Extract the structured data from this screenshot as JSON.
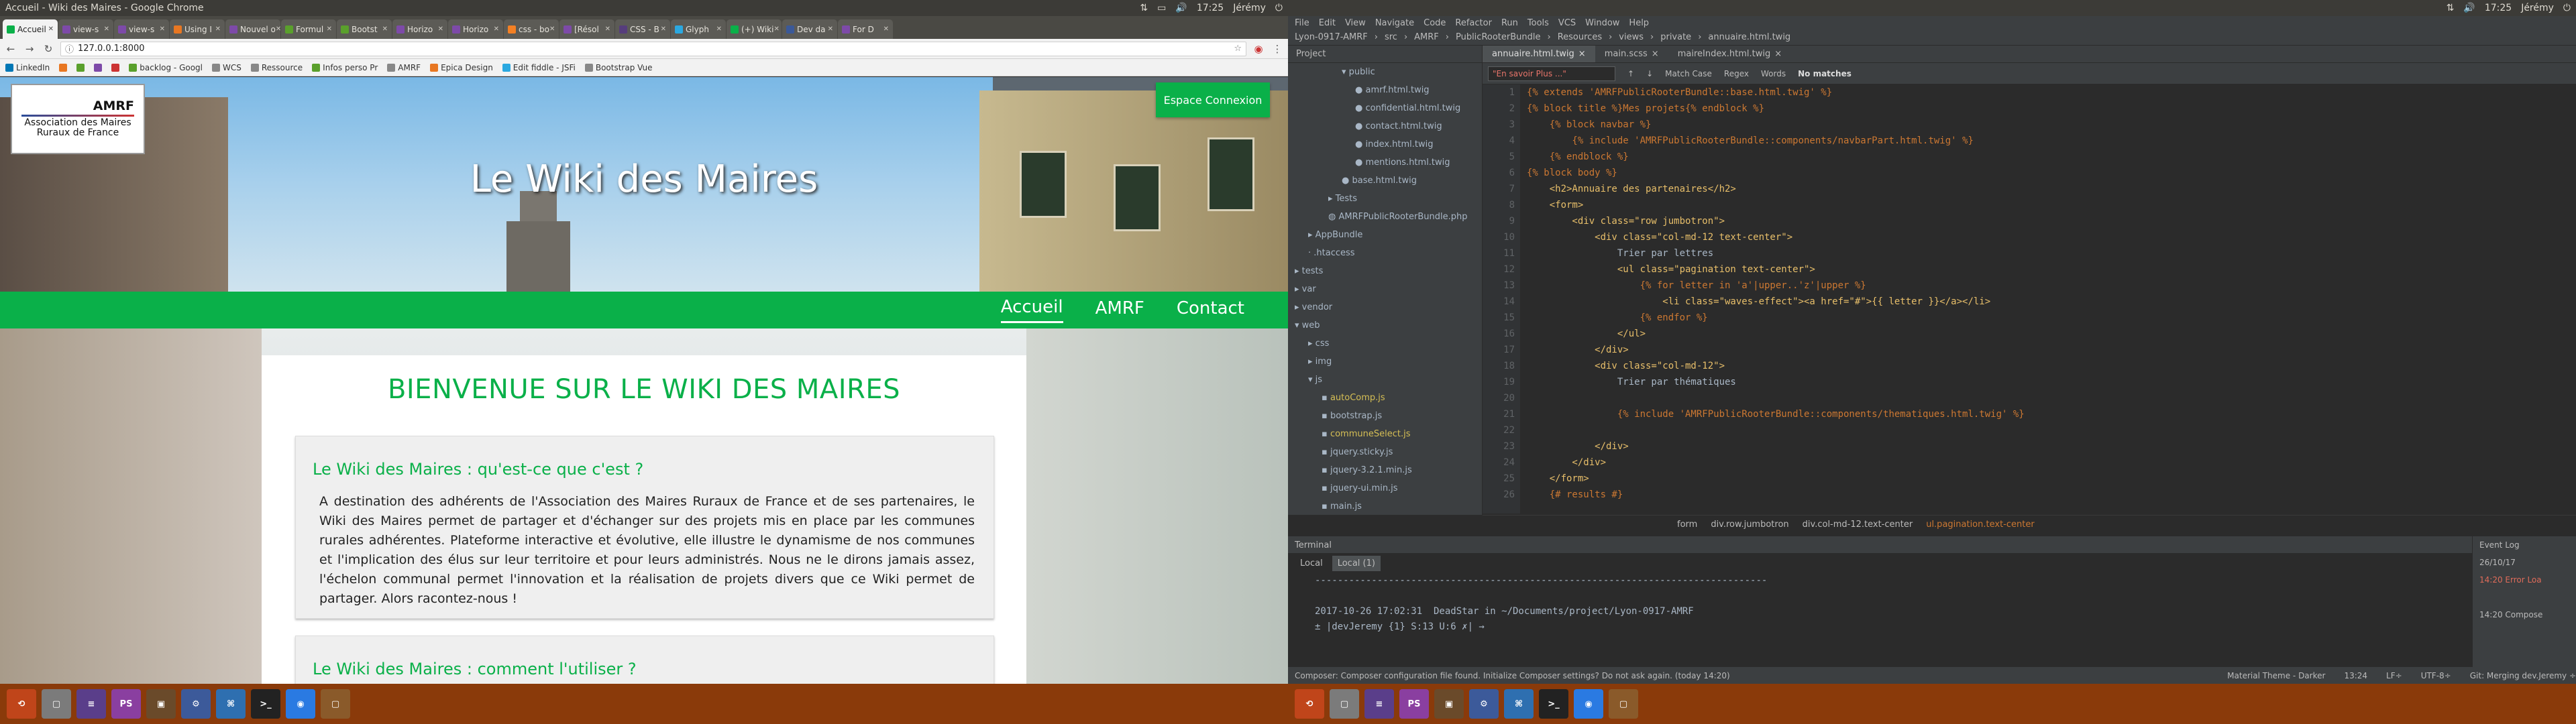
{
  "left": {
    "window_title": "Accueil - Wiki des Maires - Google Chrome",
    "tray": [
      "Jérémy"
    ],
    "tray_time": "17:25",
    "tabs": [
      {
        "label": "Accueil",
        "fav": "#0ab049"
      },
      {
        "label": "view-s",
        "fav": "#7d4aa8"
      },
      {
        "label": "view-s",
        "fav": "#7d4aa8"
      },
      {
        "label": "Using I",
        "fav": "#e87722"
      },
      {
        "label": "Nouvel o",
        "fav": "#7d4aa8"
      },
      {
        "label": "Formul",
        "fav": "#5aa02c"
      },
      {
        "label": "Bootst",
        "fav": "#5aa02c"
      },
      {
        "label": "Horizo",
        "fav": "#7d4aa8"
      },
      {
        "label": "Horizo",
        "fav": "#7d4aa8"
      },
      {
        "label": "css - bo",
        "fav": "#f48024"
      },
      {
        "label": "[Résol",
        "fav": "#7d4aa8"
      },
      {
        "label": "CSS - B",
        "fav": "#563d7c"
      },
      {
        "label": "Glyph",
        "fav": "#2ba8e0"
      },
      {
        "label": "(+) Wiki",
        "fav": "#0ab049"
      },
      {
        "label": "Dev da",
        "fav": "#3b5998"
      },
      {
        "label": "For D",
        "fav": "#7d4aa8"
      }
    ],
    "url": "127.0.0.1:8000",
    "bookmarks": [
      {
        "label": "LinkedIn",
        "color": "#0077b5"
      },
      {
        "label": "",
        "color": "#e87722"
      },
      {
        "label": "",
        "color": "#5aa02c"
      },
      {
        "label": "",
        "color": "#7d4aa8"
      },
      {
        "label": "",
        "color": "#c33"
      },
      {
        "label": "backlog - Googl",
        "color": "#5aa02c"
      },
      {
        "label": "WCS",
        "color": "#888"
      },
      {
        "label": "Ressource",
        "color": "#888"
      },
      {
        "label": "Infos perso Pr",
        "color": "#5aa02c"
      },
      {
        "label": "AMRF",
        "color": "#888"
      },
      {
        "label": "Epica Design",
        "color": "#e87722"
      },
      {
        "label": "Edit fiddle - JSFi",
        "color": "#2ba8e0"
      },
      {
        "label": "Bootstrap Vue",
        "color": "#888"
      }
    ],
    "site": {
      "logo_mark": "AMRF",
      "logo_line1": "Association des Maires",
      "logo_line2": "Ruraux de France",
      "espace": "Espace Connexion",
      "title": "Le Wiki des Maires",
      "nav": [
        "Accueil",
        "AMRF",
        "Contact"
      ],
      "heading": "BIENVENUE SUR LE WIKI DES MAIRES",
      "panel1_title": "Le Wiki des Maires : qu'est-ce que c'est ?",
      "panel1_text": "A destination des adhérents de l'Association des Maires Ruraux de France et de ses partenaires, le Wiki des Maires permet de partager et d'échanger sur des projets mis en place par les communes rurales adhérentes. Plateforme interactive et évolutive, elle illustre le dynamisme de nos communes et l'implication des élus sur leur territoire et pour leurs administrés. Nous ne le dirons jamais assez, l'échelon communal permet l'innovation et la réalisation de projets divers que ce Wiki permet de partager. Alors racontez-nous !",
      "panel2_title": "Le Wiki des Maires : comment l'utiliser ?"
    },
    "taskbar": [
      "⟲",
      "▢",
      "≡",
      "PS",
      "▣",
      "⚙",
      "⌘",
      ">_",
      "◉",
      "▢"
    ]
  },
  "right": {
    "tray_time": "17:25",
    "tray_user": "Jérémy",
    "menu": [
      "File",
      "Edit",
      "View",
      "Navigate",
      "Code",
      "Refactor",
      "Run",
      "Tools",
      "VCS",
      "Window",
      "Help"
    ],
    "breadcrumb": [
      "Lyon-0917-AMRF",
      "src",
      "AMRF",
      "PublicRooterBundle",
      "Resources",
      "views",
      "private",
      "annuaire.html.twig"
    ],
    "project_label": "Project",
    "tree": [
      {
        "label": "public",
        "indent": 80,
        "color": "#a9b7c6",
        "icon": "▾"
      },
      {
        "label": "amrf.html.twig",
        "indent": 100,
        "color": "#a9b7c6",
        "icon": "●"
      },
      {
        "label": "confidential.html.twig",
        "indent": 100,
        "color": "#a9b7c6",
        "icon": "●"
      },
      {
        "label": "contact.html.twig",
        "indent": 100,
        "color": "#a9b7c6",
        "icon": "●"
      },
      {
        "label": "index.html.twig",
        "indent": 100,
        "color": "#a9b7c6",
        "icon": "●"
      },
      {
        "label": "mentions.html.twig",
        "indent": 100,
        "color": "#a9b7c6",
        "icon": "●"
      },
      {
        "label": "base.html.twig",
        "indent": 80,
        "color": "#a9b7c6",
        "icon": "●"
      },
      {
        "label": "Tests",
        "indent": 60,
        "color": "#a9b7c6",
        "icon": "▸"
      },
      {
        "label": "AMRFPublicRooterBundle.php",
        "indent": 60,
        "color": "#a9b7c6",
        "icon": "◍"
      },
      {
        "label": "AppBundle",
        "indent": 30,
        "color": "#a9b7c6",
        "icon": "▸"
      },
      {
        "label": ".htaccess",
        "indent": 30,
        "color": "#a9b7c6",
        "icon": "·"
      },
      {
        "label": "tests",
        "indent": 10,
        "color": "#a9b7c6",
        "icon": "▸"
      },
      {
        "label": "var",
        "indent": 10,
        "color": "#a9b7c6",
        "icon": "▸"
      },
      {
        "label": "vendor",
        "indent": 10,
        "color": "#a9b7c6",
        "icon": "▸"
      },
      {
        "label": "web",
        "indent": 10,
        "color": "#a9b7c6",
        "icon": "▾"
      },
      {
        "label": "css",
        "indent": 30,
        "color": "#a9b7c6",
        "icon": "▸"
      },
      {
        "label": "img",
        "indent": 30,
        "color": "#a9b7c6",
        "icon": "▸"
      },
      {
        "label": "js",
        "indent": 30,
        "color": "#a9b7c6",
        "icon": "▾"
      },
      {
        "label": "autoComp.js",
        "indent": 50,
        "color": "#d6bf55",
        "icon": "▪"
      },
      {
        "label": "bootstrap.js",
        "indent": 50,
        "color": "#a9b7c6",
        "icon": "▪"
      },
      {
        "label": "communeSelect.js",
        "indent": 50,
        "color": "#d6bf55",
        "icon": "▪"
      },
      {
        "label": "jquery.sticky.js",
        "indent": 50,
        "color": "#a9b7c6",
        "icon": "▪"
      },
      {
        "label": "jquery-3.2.1.min.js",
        "indent": 50,
        "color": "#a9b7c6",
        "icon": "▪"
      },
      {
        "label": "jquery-ui.min.js",
        "indent": 50,
        "color": "#a9b7c6",
        "icon": "▪"
      },
      {
        "label": "main.js",
        "indent": 50,
        "color": "#a9b7c6",
        "icon": "▪"
      }
    ],
    "editor_tabs": [
      "annuaire.html.twig",
      "main.scss",
      "maireIndex.html.twig"
    ],
    "find_query": "\"En savoir Plus ...\"",
    "find_opts": [
      "Match Case",
      "Regex",
      "Words"
    ],
    "find_result": "No matches",
    "code_lines": [
      "{% extends 'AMRFPublicRooterBundle::base.html.twig' %}",
      "{% block title %}Mes projets{% endblock %}",
      "    {% block navbar %}",
      "        {% include 'AMRFPublicRooterBundle::components/navbarPart.html.twig' %}",
      "    {% endblock %}",
      "{% block body %}",
      "    <h2>Annuaire des partenaires</h2>",
      "    <form>",
      "        <div class=\"row jumbotron\">",
      "            <div class=\"col-md-12 text-center\">",
      "                Trier par lettres",
      "                <ul class=\"pagination text-center\">",
      "                    {% for letter in 'a'|upper..'z'|upper %}",
      "                        <li class=\"waves-effect\"><a href=\"#\">{{ letter }}</a></li>",
      "                    {% endfor %}",
      "                </ul>",
      "            </div>",
      "            <div class=\"col-md-12\">",
      "                Trier par thématiques",
      "",
      "                {% include 'AMRFPublicRooterBundle::components/thematiques.html.twig' %}",
      "",
      "            </div>",
      "        </div>",
      "    </form>",
      "    {# results #}"
    ],
    "code_status": [
      "form",
      "div.row.jumbotron",
      "div.col-md-12.text-center",
      "ul.pagination.text-center"
    ],
    "terminal_label": "Terminal",
    "terminal_tabs": [
      "Local",
      "Local (1)"
    ],
    "terminal_lines": [
      "--------------------------------------------------------------------------------",
      "",
      "2017-10-26 17:02:31  DeadStar in ~/Documents/project/Lyon-0917-AMRF",
      "± |devJeremy {1} S:13 U:6 ✗| →"
    ],
    "event_log_label": "Event Log",
    "event_log": [
      "26/10/17",
      "14:20  Error Loa",
      "",
      "14:20  Compose"
    ],
    "status_msg": "Composer: Composer configuration file found. Initialize Composer settings? Do not ask again. (today 14:20)",
    "status_right": [
      "Material Theme - Darker",
      "13:24",
      "LF÷",
      "UTF-8÷",
      "Git: Merging dev.Jeremy ÷"
    ],
    "taskbar": [
      "⟲",
      "▢",
      "≡",
      "PS",
      "▣",
      "⚙",
      "⌘",
      ">_",
      "◉",
      "▢"
    ]
  }
}
